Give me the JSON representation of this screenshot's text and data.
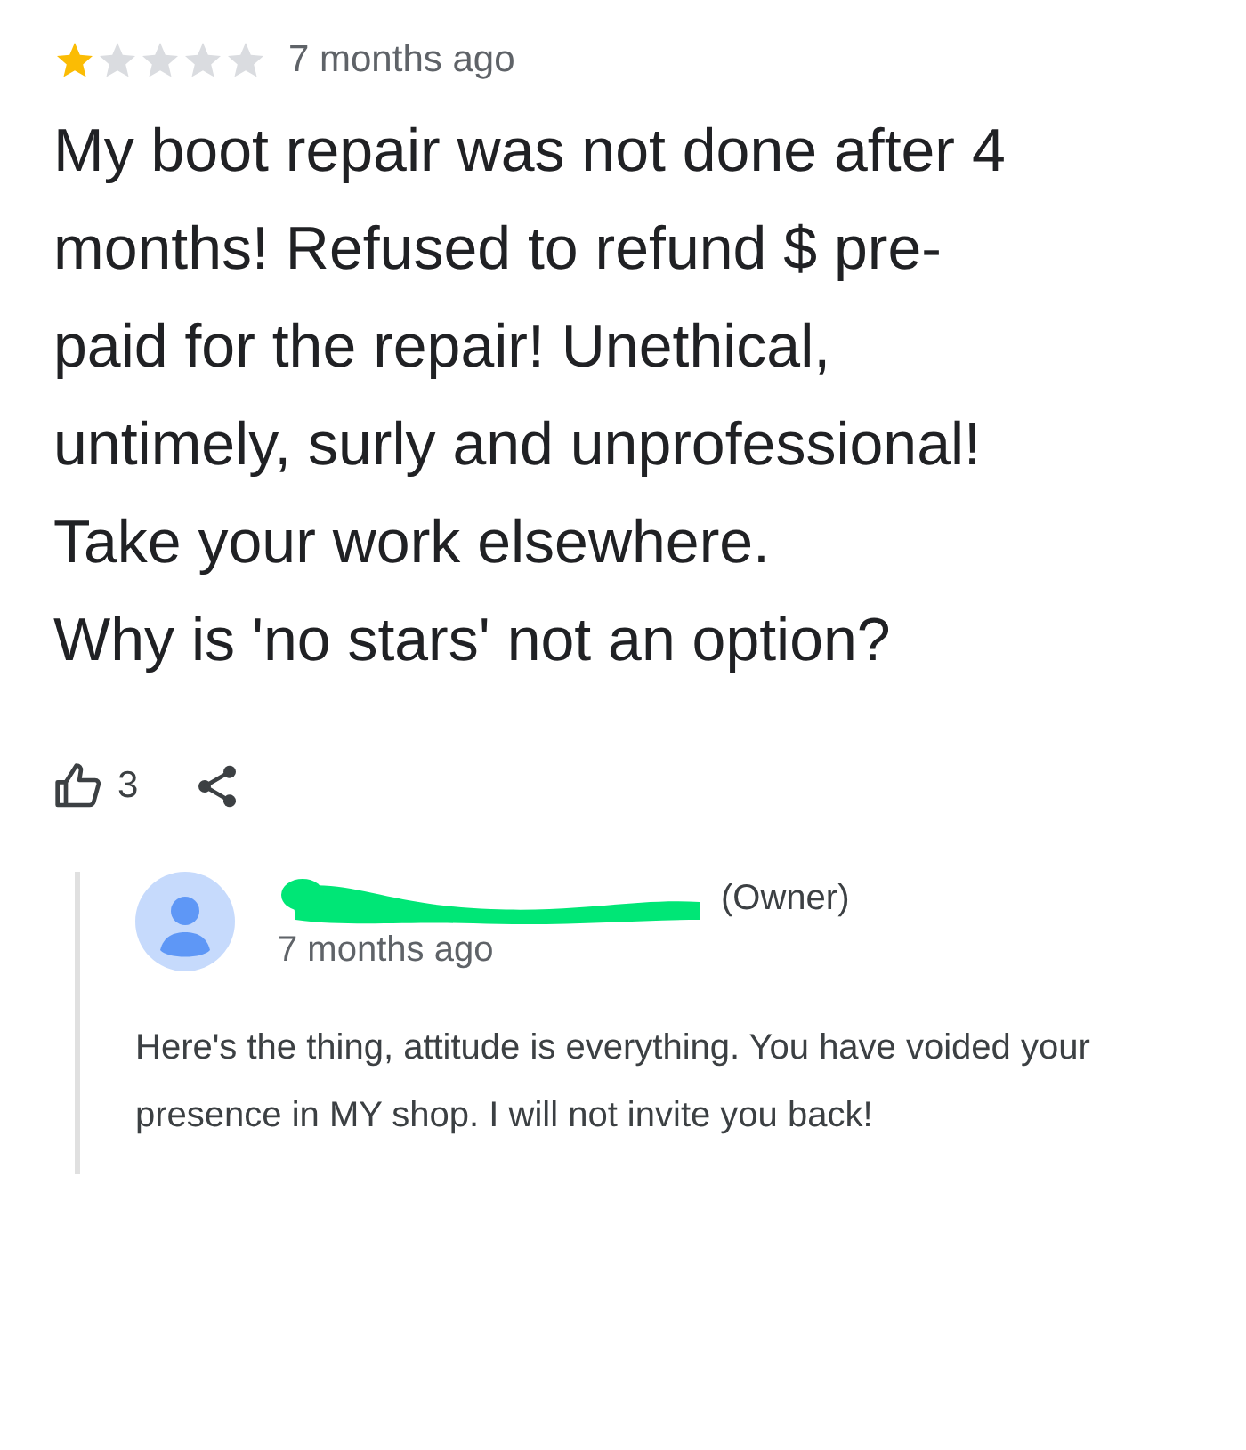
{
  "review": {
    "stars": 1,
    "time": "7 months ago",
    "text": "My boot repair was not done after 4 months! Refused to refund $ pre-paid for the repair! Unethical, untimely, surly and unprofessional! Take your work elsewhere.",
    "text_2": "Why is 'no stars' not an option?",
    "likes": "3"
  },
  "reply": {
    "role": "(Owner)",
    "time": "7 months ago",
    "text": "Here's the thing, attitude is everything. You have voided your presence in MY shop. I will not invite you back!"
  }
}
